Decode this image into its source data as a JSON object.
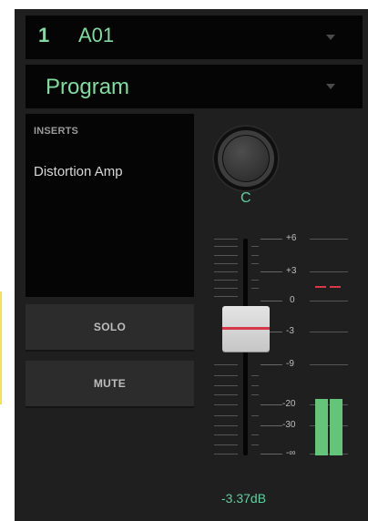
{
  "track": {
    "number": "1",
    "name": "A01"
  },
  "track_type": "Program",
  "inserts": {
    "title": "INSERTS",
    "slots": [
      "Distortion Amp"
    ]
  },
  "buttons": {
    "solo": "SOLO",
    "mute": "MUTE"
  },
  "pan": {
    "value": "C"
  },
  "fader": {
    "scale_labels": [
      "+6",
      "+3",
      "0",
      "-3",
      "-9",
      "-20",
      "-30",
      "-∞"
    ],
    "level_db": "-3.37dB"
  },
  "meter": {
    "left_level": 0.25,
    "right_level": 0.25,
    "peak_color": "#d8374a",
    "bar_color": "#64c57a"
  },
  "colors": {
    "accent": "#7fdca0",
    "value_text": "#5ed1a0",
    "fader_line": "#d8374a"
  }
}
